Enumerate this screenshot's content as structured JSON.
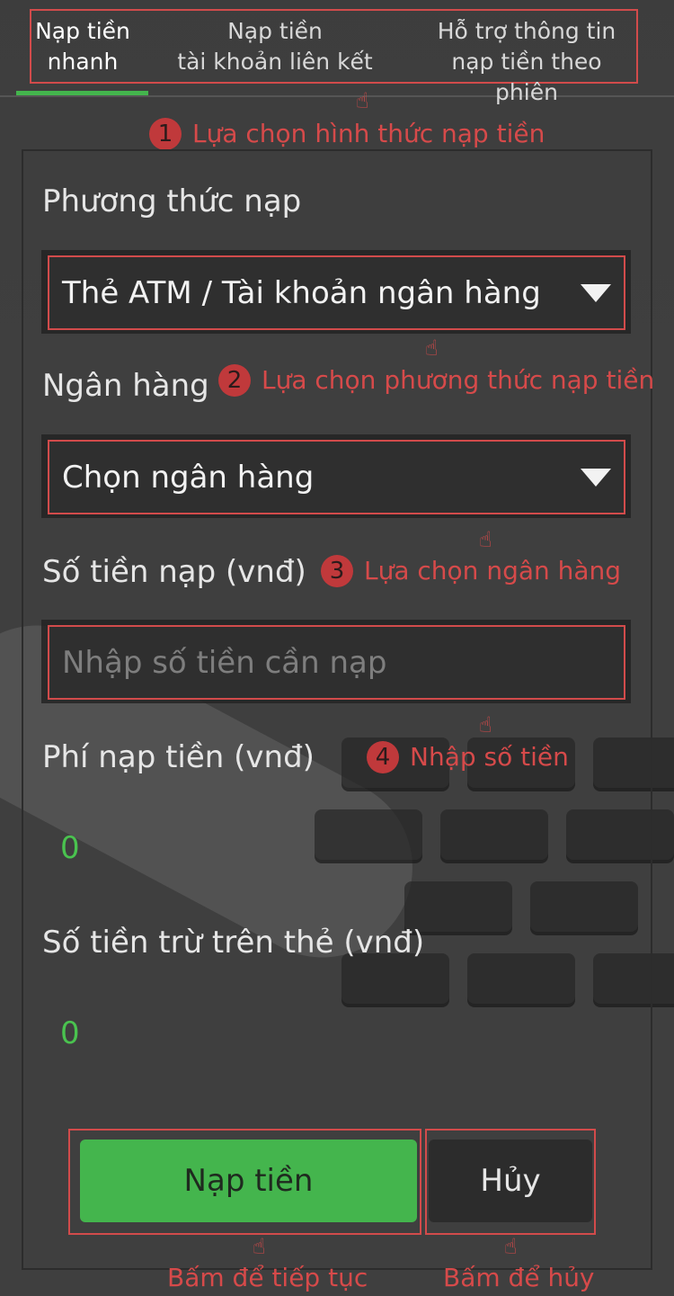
{
  "tabs": [
    {
      "line1": "Nạp tiền",
      "line2": "nhanh"
    },
    {
      "line1": "Nạp tiền",
      "line2": "tài khoản liên kết"
    },
    {
      "line1": "Hỗ trợ thông tin",
      "line2": "nạp tiền theo phiên"
    }
  ],
  "annotations": {
    "step1": {
      "num": "1",
      "text": "Lựa chọn hình thức nạp tiền"
    },
    "step2": {
      "num": "2",
      "text": "Lựa chọn phương thức nạp tiền"
    },
    "step3": {
      "num": "3",
      "text": "Lựa chọn ngân hàng"
    },
    "step4": {
      "num": "4",
      "text": "Nhập số tiền"
    },
    "continue": "Bấm để tiếp tục",
    "cancel": "Bấm để hủy"
  },
  "form": {
    "method_label": "Phương thức nạp",
    "method_value": "Thẻ ATM / Tài khoản ngân hàng",
    "bank_label": "Ngân hàng",
    "bank_value": "Chọn ngân hàng",
    "amount_label": "Số tiền nạp (vnđ)",
    "amount_placeholder": "Nhập số tiền cần nạp",
    "fee_label": "Phí nạp tiền (vnđ)",
    "fee_value": "0",
    "deduct_label": "Số tiền trừ trên thẻ (vnđ)",
    "deduct_value": "0"
  },
  "buttons": {
    "submit": "Nạp tiền",
    "cancel": "Hủy"
  },
  "icons": {
    "pointer": "pointing-hand-icon",
    "dropdown": "caret-down-icon"
  },
  "colors": {
    "accent": "#44b54d",
    "annotation": "#d24b4b",
    "background": "#3f3f3f"
  }
}
